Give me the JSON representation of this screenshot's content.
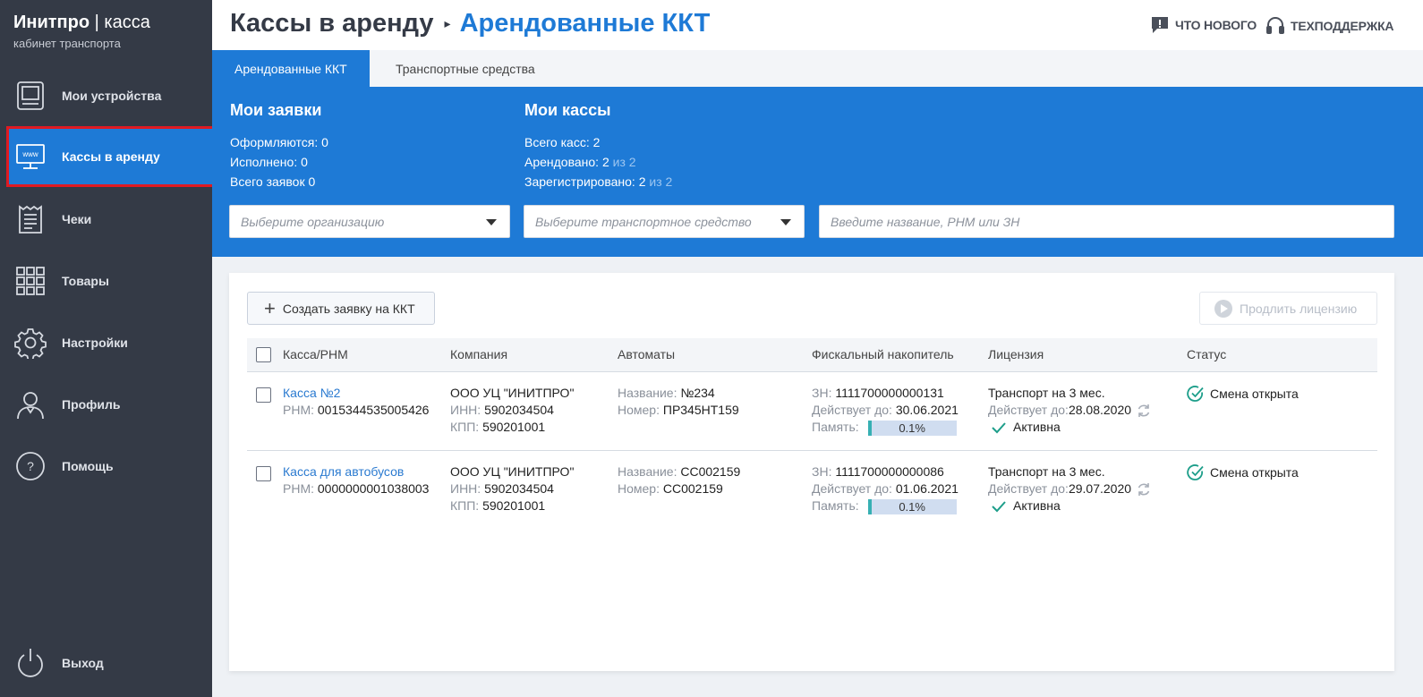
{
  "brand": {
    "title_bold": "Инитпро",
    "separator": " | ",
    "title_light": "касса",
    "subtitle": "кабинет транспорта"
  },
  "sidebar": {
    "items": [
      {
        "label": "Мои устройства",
        "icon": "device-icon"
      },
      {
        "label": "Кассы в аренду",
        "icon": "www-monitor-icon",
        "active": true
      },
      {
        "label": "Чеки",
        "icon": "receipt-icon"
      },
      {
        "label": "Товары",
        "icon": "grid-icon"
      },
      {
        "label": "Настройки",
        "icon": "gear-icon"
      },
      {
        "label": "Профиль",
        "icon": "user-icon"
      },
      {
        "label": "Помощь",
        "icon": "help-icon"
      }
    ],
    "logout": {
      "label": "Выход",
      "icon": "power-icon"
    }
  },
  "header": {
    "crumb_parent": "Кассы в аренду",
    "crumb_current": "Арендованные ККТ",
    "whats_new": "ЧТО НОВОГО",
    "support": "ТЕХПОДДЕРЖКА"
  },
  "tabs": [
    {
      "label": "Арендованные ККТ",
      "active": true
    },
    {
      "label": "Транспортные средства",
      "active": false
    }
  ],
  "summary": {
    "requests": {
      "title": "Мои заявки",
      "processing": "Оформляются: 0",
      "done": "Исполнено: 0",
      "total": "Всего заявок 0"
    },
    "kkt": {
      "title": "Мои кассы",
      "total": "Всего касс: 2",
      "rented": "Арендовано: 2",
      "rented_of": " из 2",
      "registered": "Зарегистрировано: 2",
      "registered_of": " из 2"
    },
    "filters": {
      "org_placeholder": "Выберите организацию",
      "vehicle_placeholder": "Выберите транспортное средство",
      "search_placeholder": "Введите название, РНМ или ЗН"
    }
  },
  "actions": {
    "create": "Создать заявку на ККТ",
    "extend": "Продлить лицензию"
  },
  "table": {
    "columns": [
      "Касса/РНМ",
      "Компания",
      "Автоматы",
      "Фискальный накопитель",
      "Лицензия",
      "Статус"
    ],
    "labels": {
      "rnm": "РНМ: ",
      "inn": "ИНН: ",
      "kpp": "КПП: ",
      "name": "Название: ",
      "number": "Номер: ",
      "zn": "ЗН: ",
      "valid_to": "Действует до: ",
      "valid_to_short": "Действует до:",
      "memory": "Память:"
    },
    "rows": [
      {
        "kassa": "Касса №2",
        "rnm": "0015344535005426",
        "company": "ООО УЦ \"ИНИТПРО\"",
        "inn": "5902034504",
        "kpp": "590201001",
        "machine_name": "№234",
        "machine_number": "ПР345НТ159",
        "zn": "1111700000000131",
        "fn_valid": "30.06.2021",
        "memory": "0.1%",
        "memory_fraction": 0.001,
        "license": "Транспорт на 3 мес.",
        "license_valid": "28.08.2020",
        "license_state": "Активна",
        "status": "Смена открыта"
      },
      {
        "kassa": "Касса для автобусов",
        "rnm": "0000000001038003",
        "company": "ООО УЦ \"ИНИТПРО\"",
        "inn": "5902034504",
        "kpp": "590201001",
        "machine_name": "СС002159",
        "machine_number": "СС002159",
        "zn": "1111700000000086",
        "fn_valid": "01.06.2021",
        "memory": "0.1%",
        "memory_fraction": 0.001,
        "license": "Транспорт на 3 мес.",
        "license_valid": "29.07.2020",
        "license_state": "Активна",
        "status": "Смена открыта"
      }
    ]
  },
  "colors": {
    "sidebar": "#343a46",
    "accent": "#1e7ad6",
    "highlight": "#e01a22",
    "success": "#1d9e8a"
  }
}
